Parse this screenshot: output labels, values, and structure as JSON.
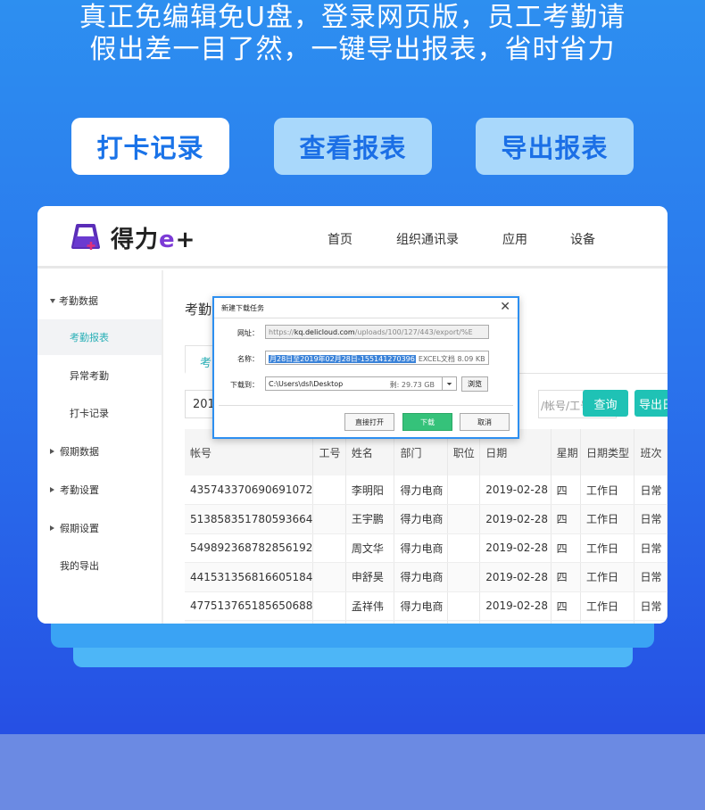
{
  "headline": {
    "line1": "真正免编辑免U盘，登录网页版，员工考勤请",
    "line2": "假出差一目了然，一键导出报表，省时省力"
  },
  "feature_tabs": [
    {
      "label": "打卡记录",
      "active": true
    },
    {
      "label": "查看报表",
      "active": false
    },
    {
      "label": "导出报表",
      "active": false
    }
  ],
  "app": {
    "logo_text": "得力",
    "logo_suffix": "e",
    "logo_plus": "+",
    "nav": [
      "首页",
      "组织通讯录",
      "应用",
      "设备"
    ],
    "sidebar": [
      {
        "label": "考勤数据",
        "kind": "group-open"
      },
      {
        "label": "考勤报表",
        "kind": "sub",
        "active": true
      },
      {
        "label": "异常考勤",
        "kind": "sub"
      },
      {
        "label": "打卡记录",
        "kind": "sub"
      },
      {
        "label": "假期数据",
        "kind": "group"
      },
      {
        "label": "考勤设置",
        "kind": "group"
      },
      {
        "label": "假期设置",
        "kind": "group"
      },
      {
        "label": "我的导出",
        "kind": "plain"
      }
    ],
    "page_title": "考勤",
    "sub_tab": "考",
    "date_value": "201",
    "search_placeholder": "/帐号/工号",
    "query_button": "查询",
    "export_button": "导出日",
    "table": {
      "columns": [
        "帐号",
        "工号",
        "姓名",
        "部门",
        "职位",
        "日期",
        "星期",
        "日期类型",
        "班次"
      ],
      "rows": [
        [
          "435743370690691072",
          "",
          "李明阳",
          "得力电商",
          "",
          "2019-02-28",
          "四",
          "工作日",
          "日常"
        ],
        [
          "513858351780593664",
          "",
          "王宇鹏",
          "得力电商",
          "",
          "2019-02-28",
          "四",
          "工作日",
          "日常"
        ],
        [
          "549892368782856192",
          "",
          "周文华",
          "得力电商",
          "",
          "2019-02-28",
          "四",
          "工作日",
          "日常"
        ],
        [
          "441531356816605184",
          "",
          "申舒昊",
          "得力电商",
          "",
          "2019-02-28",
          "四",
          "工作日",
          "日常"
        ],
        [
          "477513765185650688",
          "",
          "孟祥伟",
          "得力电商",
          "",
          "2019-02-28",
          "四",
          "工作日",
          "日常"
        ],
        [
          "",
          "",
          "",
          "",
          "",
          "",
          "",
          "",
          ""
        ]
      ]
    }
  },
  "dialog": {
    "title": "新建下载任务",
    "close_glyph": "✕",
    "url_label": "网址：",
    "url_prefix": "https://",
    "url_host": "kq.delicloud.com",
    "url_path": "/uploads/100/127/443/export/%E",
    "name_label": "名称：",
    "name_value": "月28日至2019年02月28日-155141270396",
    "name_meta": "EXCEL文档 8.09 KB",
    "path_label": "下载到：",
    "path_value": "C:\\Users\\dsl\\Desktop",
    "path_free": "剩: 29.73 GB",
    "browse": "浏览",
    "btn_open": "直接打开",
    "btn_download": "下载",
    "btn_cancel": "取消"
  },
  "colors": {
    "accent_teal": "#1fc2b5",
    "brand_blue": "#1a73e8",
    "download_green": "#35c27a"
  }
}
